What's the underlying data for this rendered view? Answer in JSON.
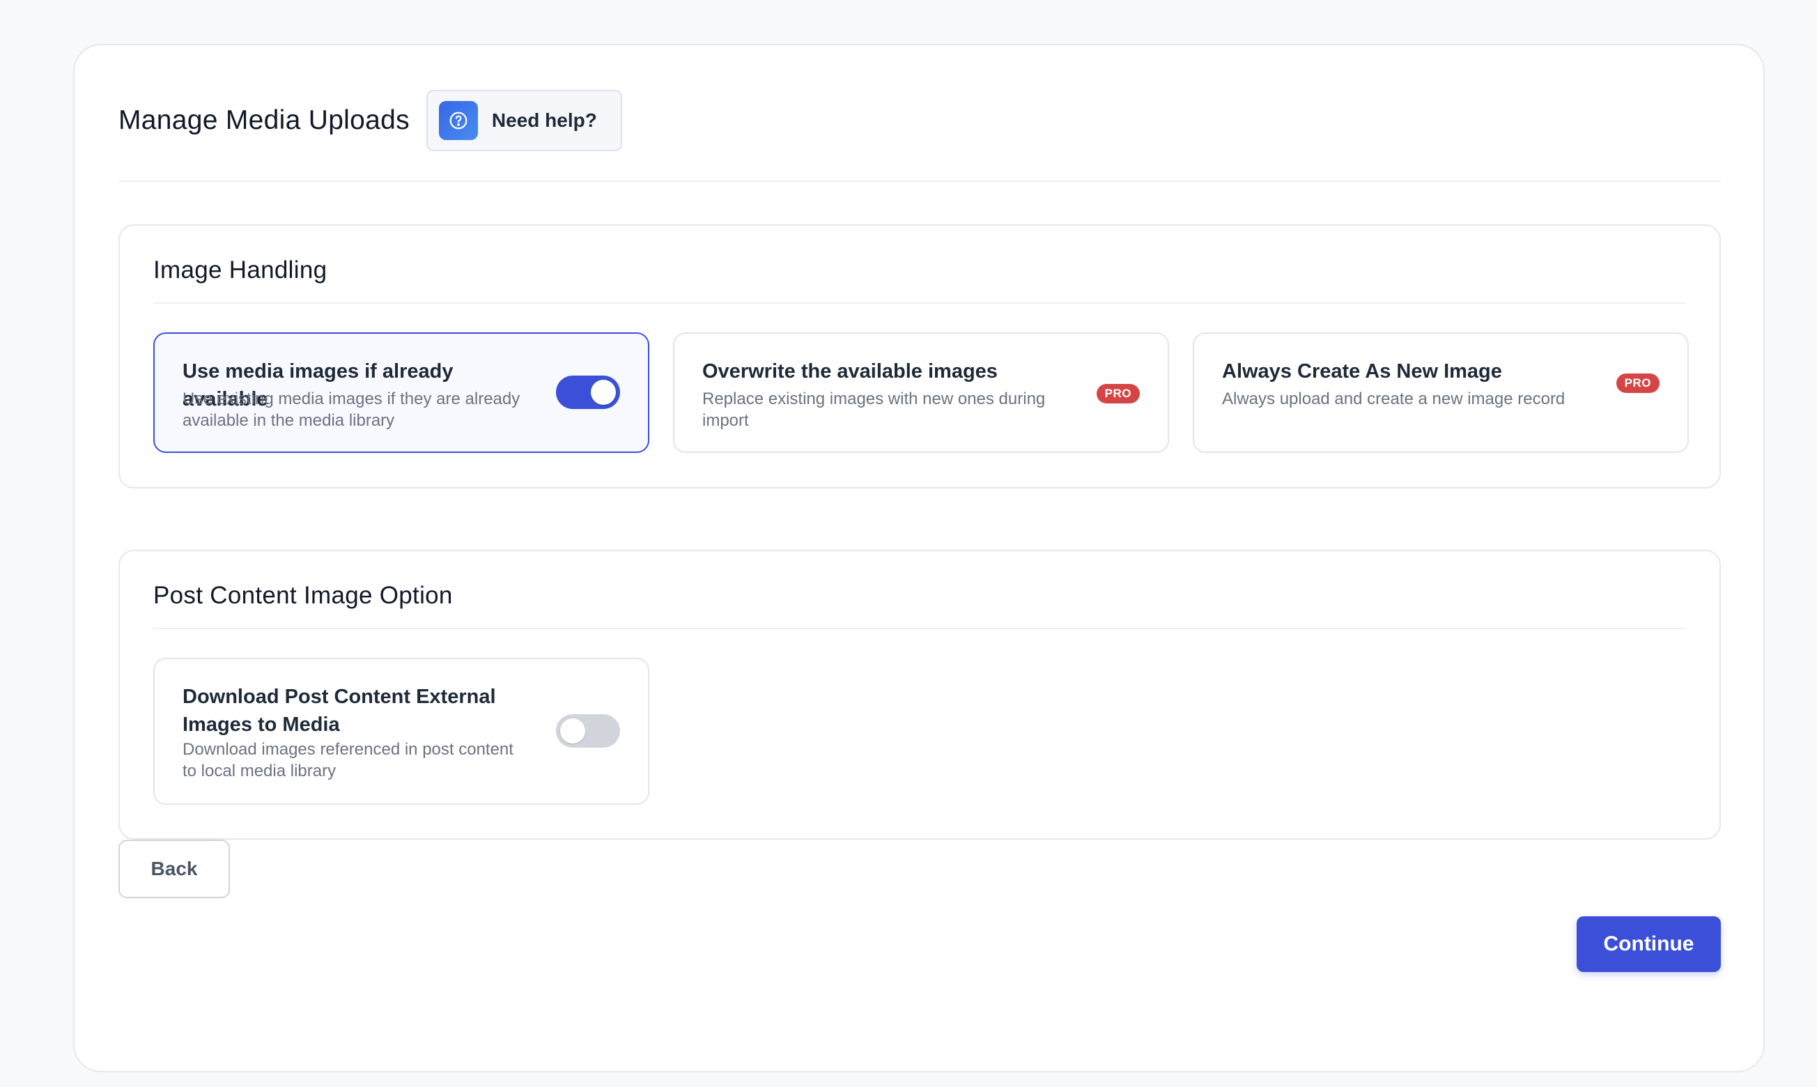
{
  "page": {
    "title": "Manage Media Uploads",
    "help_label": "Need help?"
  },
  "image_handling": {
    "title": "Image Handling",
    "options": [
      {
        "title": "Use media images if already available",
        "description": "Use existing media images if they are already available in the media library",
        "enabled": true,
        "selected": true
      },
      {
        "title": "Overwrite the available images",
        "description": "Replace existing images with new ones during import",
        "badge": "PRO"
      },
      {
        "title": "Always Create As New Image",
        "description": "Always upload and create a new image record",
        "badge": "PRO"
      }
    ]
  },
  "post_content": {
    "title": "Post Content Image Option",
    "option": {
      "title": "Download Post Content External Images to Media",
      "description": "Download images referenced in post content to local media library",
      "enabled": false
    }
  },
  "actions": {
    "back_label": "Back",
    "continue_label": "Continue"
  },
  "colors": {
    "accent": "#3b4fd8",
    "pro_badge": "#d64545",
    "help_icon": "#3567e6"
  },
  "icons": {
    "help": "help-circle-icon"
  }
}
